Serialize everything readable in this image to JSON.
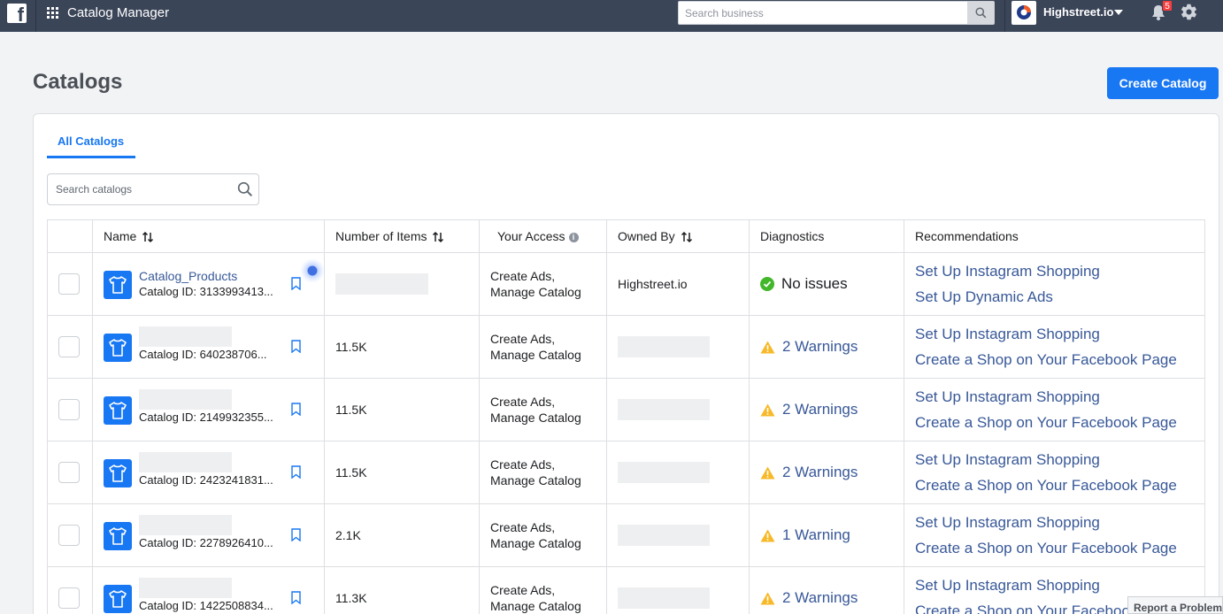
{
  "topbar": {
    "app_title": "Catalog Manager",
    "search_placeholder": "Search business",
    "business_name": "Highstreet.io",
    "notification_count": "5"
  },
  "page": {
    "title": "Catalogs",
    "create_button": "Create Catalog"
  },
  "tabs": [
    {
      "label": "All Catalogs",
      "active": true
    }
  ],
  "search": {
    "placeholder": "Search catalogs"
  },
  "table": {
    "columns": [
      "Name",
      "Number of Items",
      "Your Access",
      "Owned By",
      "Diagnostics",
      "Recommendations"
    ],
    "rows": [
      {
        "name": "Catalog_Products",
        "catalog_id": "Catalog ID: 3133993413...",
        "items": "",
        "access_1": "Create Ads,",
        "access_2": "Manage Catalog",
        "owner": "Highstreet.io",
        "diagnostics": "No issues",
        "diag_status": "ok",
        "rec_1": "Set Up Instagram Shopping",
        "rec_2": "Set Up Dynamic Ads"
      },
      {
        "name": "",
        "catalog_id": "Catalog ID: 640238706...",
        "items": "11.5K",
        "access_1": "Create Ads,",
        "access_2": "Manage Catalog",
        "owner": "",
        "diagnostics": "2 Warnings",
        "diag_status": "warning",
        "rec_1": "Set Up Instagram Shopping",
        "rec_2": "Create a Shop on Your Facebook Page"
      },
      {
        "name": "",
        "catalog_id": "Catalog ID: 2149932355...",
        "items": "11.5K",
        "access_1": "Create Ads,",
        "access_2": "Manage Catalog",
        "owner": "",
        "diagnostics": "2 Warnings",
        "diag_status": "warning",
        "rec_1": "Set Up Instagram Shopping",
        "rec_2": "Create a Shop on Your Facebook Page"
      },
      {
        "name": "",
        "catalog_id": "Catalog ID: 2423241831...",
        "items": "11.5K",
        "access_1": "Create Ads,",
        "access_2": "Manage Catalog",
        "owner": "",
        "diagnostics": "2 Warnings",
        "diag_status": "warning",
        "rec_1": "Set Up Instagram Shopping",
        "rec_2": "Create a Shop on Your Facebook Page"
      },
      {
        "name": "",
        "catalog_id": "Catalog ID: 2278926410...",
        "items": "2.1K",
        "access_1": "Create Ads,",
        "access_2": "Manage Catalog",
        "owner": "",
        "diagnostics": "1 Warning",
        "diag_status": "warning",
        "rec_1": "Set Up Instagram Shopping",
        "rec_2": "Create a Shop on Your Facebook Page"
      },
      {
        "name": "",
        "catalog_id": "Catalog ID: 1422508834...",
        "items": "11.3K",
        "access_1": "Create Ads,",
        "access_2": "Manage Catalog",
        "owner": "",
        "diagnostics": "2 Warnings",
        "diag_status": "warning",
        "rec_1": "Set Up Instagram Shopping",
        "rec_2": "Create a Shop on Your Facebook Page"
      }
    ]
  },
  "footer": {
    "report_problem": "Report a Problem"
  },
  "colors": {
    "accent": "#1877f2",
    "topbar": "#3b4558",
    "link": "#385898",
    "warning": "#f7b928",
    "ok": "#42b72a"
  }
}
